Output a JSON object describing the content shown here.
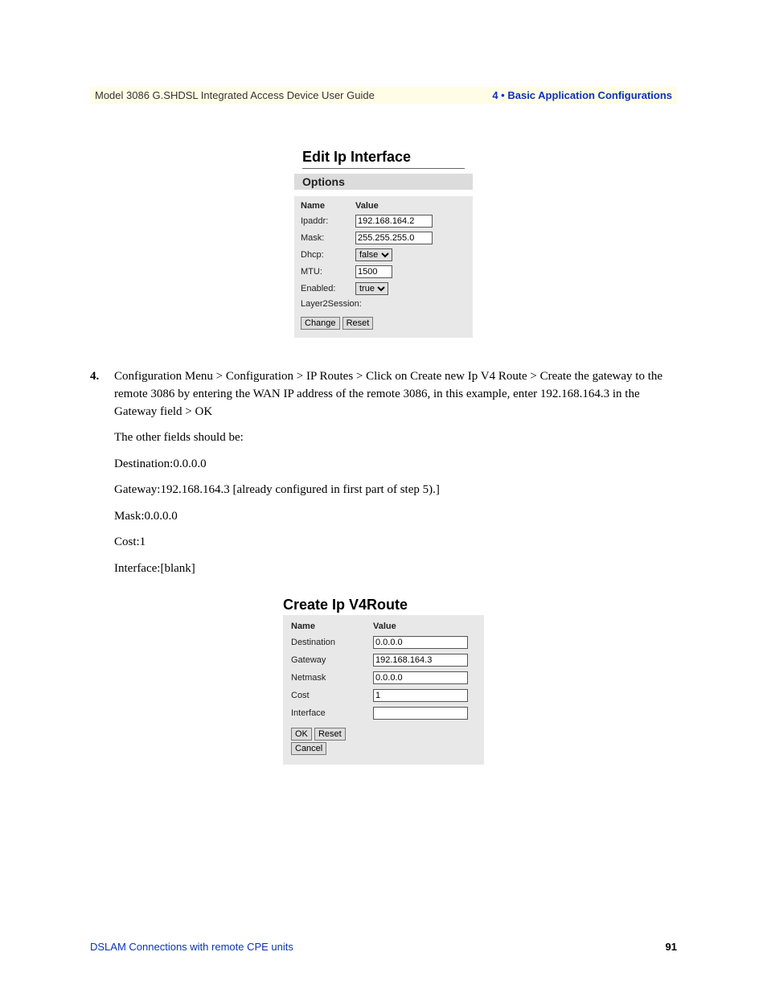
{
  "header": {
    "left": "Model 3086 G.SHDSL Integrated Access Device User Guide",
    "right": "4 • Basic Application Configurations"
  },
  "fig1": {
    "title": "Edit Ip Interface",
    "options": "Options",
    "col_name": "Name",
    "col_value": "Value",
    "rows": {
      "ipaddr_label": "Ipaddr:",
      "ipaddr_value": "192.168.164.2",
      "mask_label": "Mask:",
      "mask_value": "255.255.255.0",
      "dhcp_label": "Dhcp:",
      "dhcp_value": "false",
      "mtu_label": "MTU:",
      "mtu_value": "1500",
      "enabled_label": "Enabled:",
      "enabled_value": "true",
      "l2_label": "Layer2Session:"
    },
    "btn_change": "Change",
    "btn_reset": "Reset"
  },
  "body": {
    "step_num": "4.",
    "step_text": "Configuration Menu > Configuration > IP Routes > Click on Create new Ip V4 Route > Create the gateway to the remote 3086 by entering the WAN IP address of the remote 3086, in this example, enter 192.168.164.3 in the Gateway field > OK",
    "line_intro": "The other fields should be:",
    "line_dest": "Destination:0.0.0.0",
    "line_gw": "Gateway:192.168.164.3  [already configured in first part of step 5).]",
    "line_mask": "Mask:0.0.0.0",
    "line_cost": "Cost:1",
    "line_if": "Interface:[blank]"
  },
  "fig2": {
    "title": "Create Ip V4Route",
    "col_name": "Name",
    "col_value": "Value",
    "rows": {
      "dest_label": "Destination",
      "dest_value": "0.0.0.0",
      "gw_label": "Gateway",
      "gw_value": "192.168.164.3",
      "mask_label": "Netmask",
      "mask_value": "0.0.0.0",
      "cost_label": "Cost",
      "cost_value": "1",
      "if_label": "Interface",
      "if_value": ""
    },
    "btn_ok": "OK",
    "btn_reset": "Reset",
    "btn_cancel": "Cancel"
  },
  "footer": {
    "left": "DSLAM Connections with remote CPE units",
    "page": "91"
  }
}
